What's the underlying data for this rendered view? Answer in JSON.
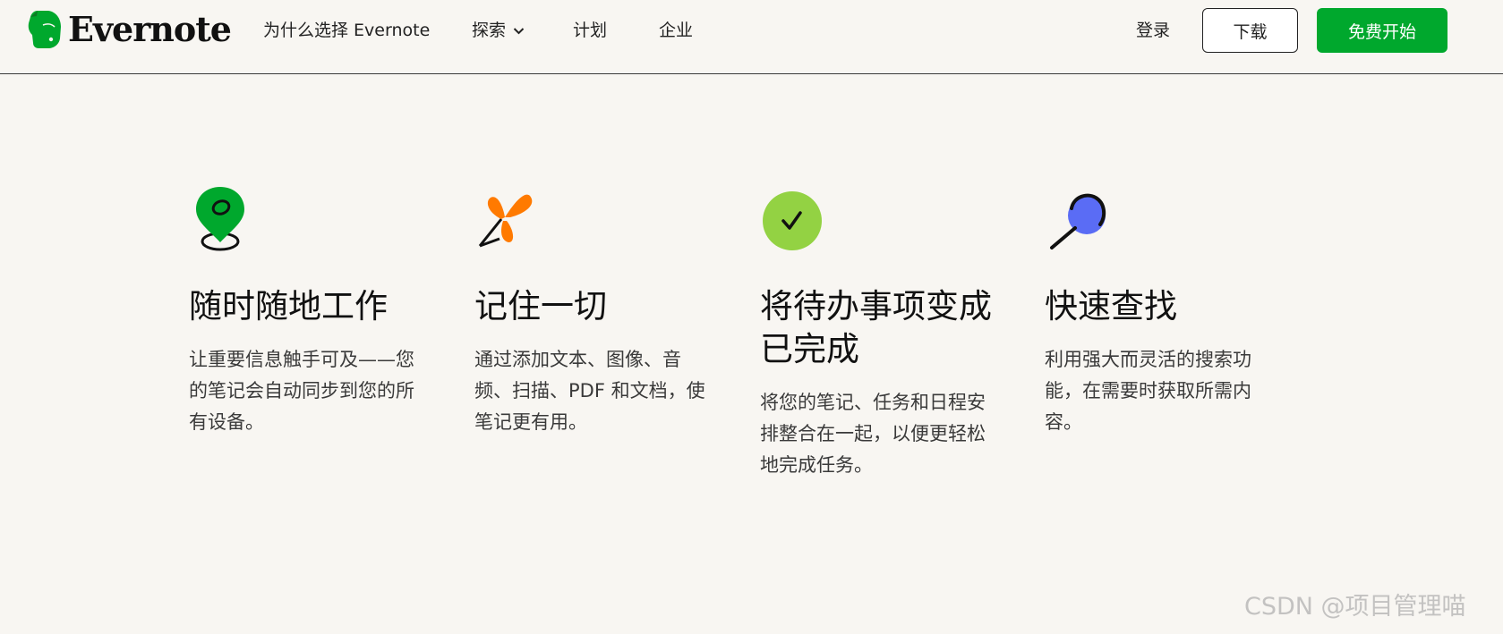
{
  "brand": {
    "name": "Evernote",
    "color": "#00a82d"
  },
  "nav": {
    "why": "为什么选择 Evernote",
    "explore": "探索",
    "plans": "计划",
    "business": "企业",
    "login": "登录",
    "download": "下载",
    "start_free": "免费开始"
  },
  "features": [
    {
      "icon": "location-pin-icon",
      "title": "随时随地工作",
      "text": "让重要信息触手可及——您的笔记会自动同步到您的所有设备。"
    },
    {
      "icon": "butterfly-clip-icon",
      "title": "记住一切",
      "text": "通过添加文本、图像、音频、扫描、PDF 和文档，使笔记更有用。"
    },
    {
      "icon": "checkmark-circle-icon",
      "title": "将待办事项变成已完成",
      "text": "将您的笔记、任务和日程安排整合在一起，以便更轻松地完成任务。"
    },
    {
      "icon": "magnifier-icon",
      "title": "快速查找",
      "text": "利用强大而灵活的搜索功能，在需要时获取所需内容。"
    }
  ],
  "watermark": "CSDN @项目管理喵"
}
